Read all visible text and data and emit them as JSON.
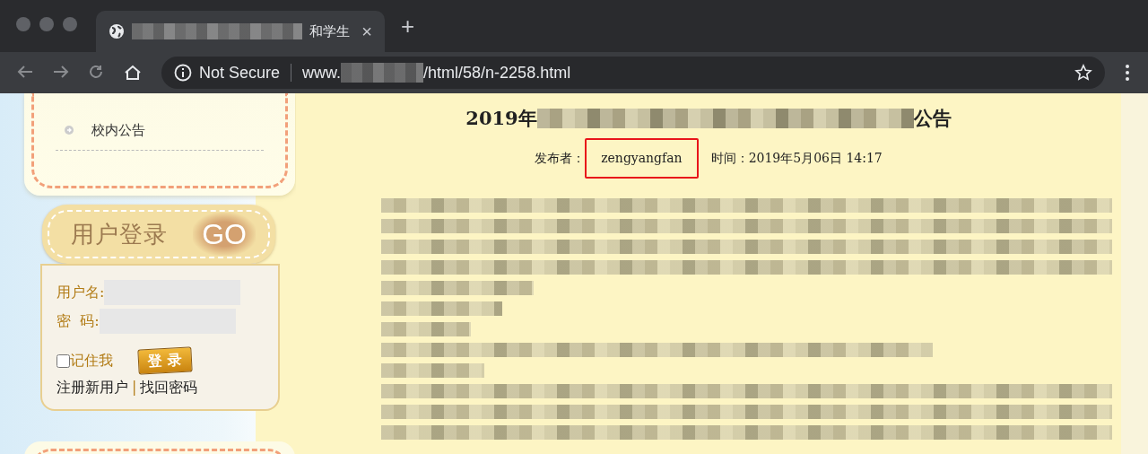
{
  "browser": {
    "tab": {
      "title_visible": "和学生",
      "close": "×"
    },
    "new_tab": "+",
    "address": {
      "security": "Not Secure",
      "url_prefix": "www.",
      "url_path": "/html/58/n-2258.html"
    }
  },
  "sidebar": {
    "menu_items": [
      {
        "label": "校内公告"
      }
    ],
    "login": {
      "header": "用户登录",
      "go": "GO",
      "username_label": "用户名:",
      "password_label": "密  码:",
      "remember": {
        "label": "记住我",
        "checked": false
      },
      "login_button": "登 录",
      "register_link": "注册新用户",
      "separator": "|",
      "forgot_link": "找回密码"
    }
  },
  "article": {
    "title_start": "2019年",
    "title_end": "公告",
    "publisher_label": "发布者：",
    "publisher": "zengyangfan",
    "publisher_highlighted": true,
    "time_label": "时间：",
    "time": "2019年5月06日 14:17"
  }
}
